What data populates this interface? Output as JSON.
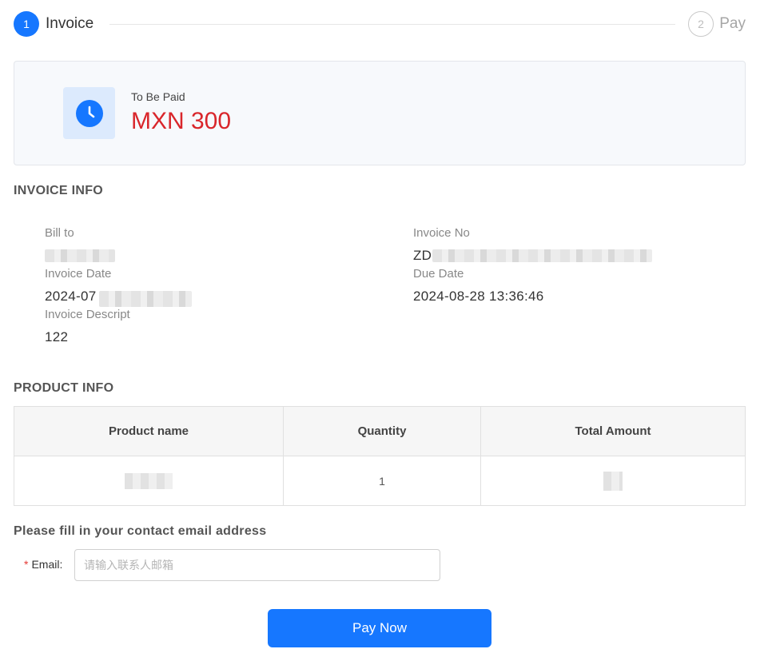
{
  "steps": [
    {
      "number": "1",
      "label": "Invoice"
    },
    {
      "number": "2",
      "label": "Pay"
    }
  ],
  "summary": {
    "status_label": "To Be Paid",
    "amount": "MXN 300",
    "icon": "clock-icon"
  },
  "invoice_info": {
    "title": "INVOICE INFO",
    "bill_to_label": "Bill to",
    "bill_to_value": "",
    "invoice_no_label": "Invoice No",
    "invoice_no_value": "ZD",
    "invoice_date_label": "Invoice Date",
    "invoice_date_value": "2024-07",
    "due_date_label": "Due Date",
    "due_date_value": "2024-08-28 13:36:46",
    "description_label": "Invoice Descript",
    "description_value": "122"
  },
  "product_info": {
    "title": "PRODUCT INFO",
    "columns": [
      "Product name",
      "Quantity",
      "Total Amount"
    ],
    "rows": [
      {
        "quantity": "1"
      }
    ]
  },
  "contact": {
    "title": "Please fill in your contact email address",
    "email_label": "Email",
    "email_colon": ":",
    "required_mark": "*",
    "email_placeholder": "请输入联系人邮箱"
  },
  "pay_button_label": "Pay Now",
  "colors": {
    "primary": "#1677ff",
    "amount_red": "#d9262b"
  }
}
